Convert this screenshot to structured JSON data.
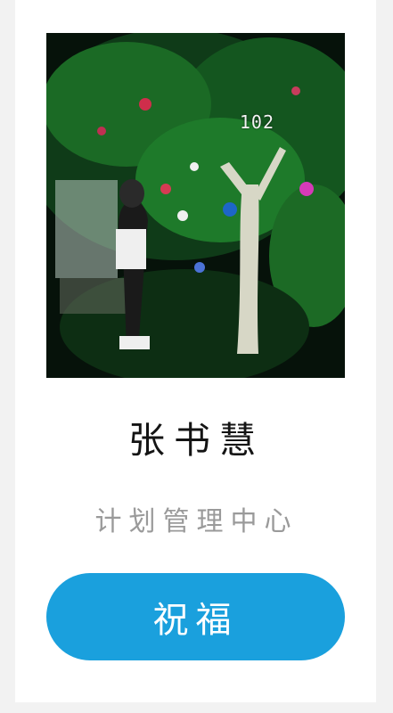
{
  "photo": {
    "overlay_number": "102",
    "icon": "photo-tree-night"
  },
  "profile": {
    "name": "张书慧",
    "subtitle": "计划管理中心"
  },
  "actions": {
    "bless_label": "祝福"
  },
  "colors": {
    "button_bg": "#1aa0dd",
    "button_text": "#ffffff",
    "name_text": "#141414",
    "subtitle_text": "#9a9a9a",
    "page_bg": "#f2f2f2"
  }
}
